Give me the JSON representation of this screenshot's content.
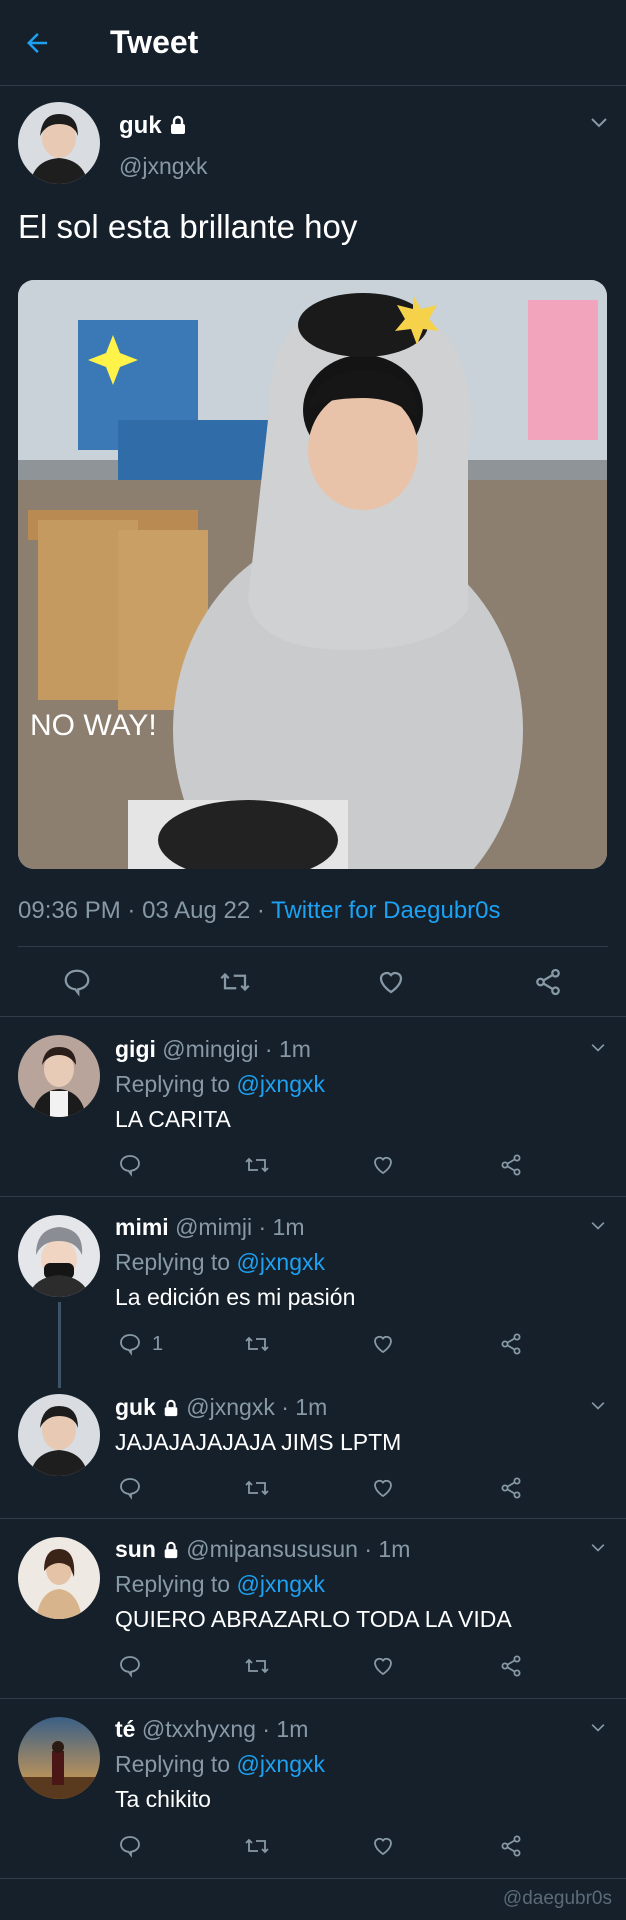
{
  "header": {
    "title": "Tweet",
    "back_icon": "arrow-left-icon"
  },
  "colors": {
    "background": "#15202b",
    "accent": "#1da1f2",
    "secondary_text": "#8899a6"
  },
  "main_tweet": {
    "name": "guk",
    "handle": "@jxngxk",
    "text": "El sol esta brillante hoy",
    "photo_caption": "NO WAY!",
    "time": "09:36 PM",
    "date": "03 Aug 22",
    "source": "Twitter for Daegubr0s",
    "separator": "·"
  },
  "replies": [
    {
      "name": "gigi",
      "handle": "@mingigi",
      "time": "1m",
      "replying_label": "Replying to",
      "replying_to": "@jxngxk",
      "text": "LA CARITA",
      "reply_count": ""
    },
    {
      "name": "mimi",
      "handle": "@mimji",
      "time": "1m",
      "replying_label": "Replying to",
      "replying_to": "@jxngxk",
      "text": "La edición es mi pasión",
      "reply_count": "1"
    },
    {
      "name": "guk",
      "handle": "@jxngxk",
      "time": "1m",
      "text": "JAJAJAJAJAJA JIMS LPTM",
      "reply_count": ""
    },
    {
      "name": "sun",
      "handle": "@mipansususun",
      "time": "1m",
      "replying_label": "Replying to",
      "replying_to": "@jxngxk",
      "text": "QUIERO ABRAZARLO TODA LA VIDA",
      "reply_count": ""
    },
    {
      "name": "té",
      "handle": "@txxhyxng",
      "time": "1m",
      "replying_label": "Replying to",
      "replying_to": "@jxngxk",
      "text": "Ta chikito",
      "reply_count": ""
    }
  ],
  "watermark": "@daegubr0s"
}
